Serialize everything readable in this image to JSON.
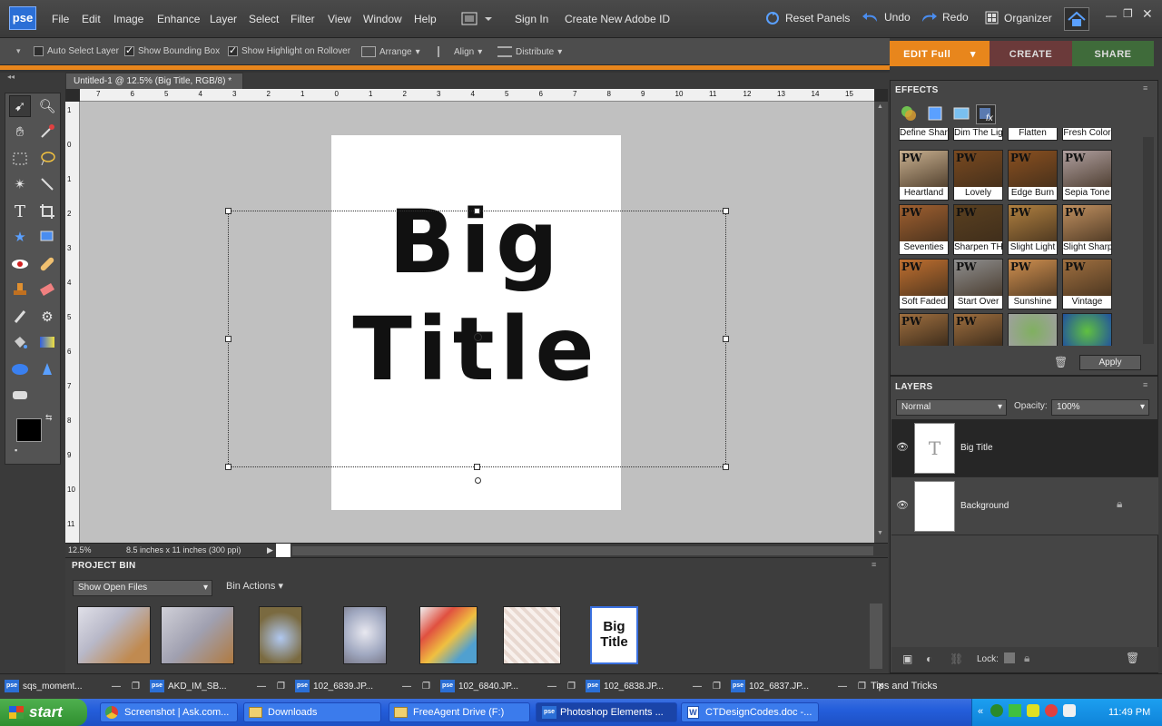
{
  "app": {
    "logo": "pse",
    "menu": [
      "File",
      "Edit",
      "Image",
      "Enhance",
      "Layer",
      "Select",
      "Filter",
      "View",
      "Window",
      "Help"
    ],
    "sign_in": "Sign In",
    "create_id": "Create New Adobe ID",
    "reset_panels": "Reset Panels",
    "undo": "Undo",
    "redo": "Redo",
    "organizer": "Organizer"
  },
  "options": {
    "auto_select": "Auto Select Layer",
    "show_bounding": "Show Bounding Box",
    "show_highlight": "Show Highlight on Rollover",
    "arrange": "Arrange",
    "align": "Align",
    "distribute": "Distribute"
  },
  "modes": {
    "edit": "EDIT Full",
    "create": "CREATE",
    "share": "SHARE"
  },
  "document": {
    "tab": "Untitled-1 @ 12.5% (Big  Title, RGB/8) *",
    "line1": "Big",
    "line2": "Title",
    "zoom": "12.5%",
    "size": "8.5 inches x 11 inches (300 ppi)"
  },
  "ruler": {
    "h": [
      "7",
      "6",
      "5",
      "4",
      "3",
      "2",
      "1",
      "0",
      "1",
      "2",
      "3",
      "4",
      "5",
      "6",
      "7",
      "8",
      "9",
      "10",
      "11",
      "12",
      "13",
      "14",
      "15"
    ],
    "v": [
      "1",
      "0",
      "1",
      "2",
      "3",
      "4",
      "5",
      "6",
      "7",
      "8",
      "9",
      "10",
      "11"
    ]
  },
  "project_bin": {
    "title": "PROJECT BIN",
    "show": "Show Open Files",
    "actions": "Bin Actions",
    "last_thumb_l1": "Big",
    "last_thumb_l2": "Title"
  },
  "effects": {
    "title": "EFFECTS",
    "top_row": [
      "Define Sharp",
      "Dim The Lights",
      "Flatten",
      "Fresh Color"
    ],
    "items": [
      "Heartland",
      "Lovely",
      "Edge Burn",
      "Sepia Tone",
      "Seventies",
      "Sharpen THIS",
      "Slight Light",
      "Slight Sharp",
      "Soft Faded",
      "Start Over",
      "Sunshine",
      "Vintage"
    ],
    "pw": "PW",
    "apply": "Apply"
  },
  "layers": {
    "title": "LAYERS",
    "blend": "Normal",
    "opacity_label": "Opacity:",
    "opacity": "100%",
    "rows": [
      {
        "name": "Big Title",
        "thumb": "T"
      },
      {
        "name": "Background",
        "thumb": ""
      }
    ],
    "lock": "Lock:"
  },
  "doc_tasks": [
    "sqs_moment...",
    "AKD_IM_SB...",
    "102_6839.JP...",
    "102_6840.JP...",
    "102_6838.JP...",
    "102_6837.JP..."
  ],
  "tips": "Tips and Tricks",
  "taskbar": {
    "start": "start",
    "items": [
      "Screenshot | Ask.com...",
      "Downloads",
      "FreeAgent Drive (F:)",
      "Photoshop Elements ...",
      "CTDesignCodes.doc -..."
    ],
    "time": "11:49 PM"
  },
  "colors": {
    "accent": "#e8861c",
    "create": "#6b3a3a",
    "share": "#3f6b3a"
  }
}
